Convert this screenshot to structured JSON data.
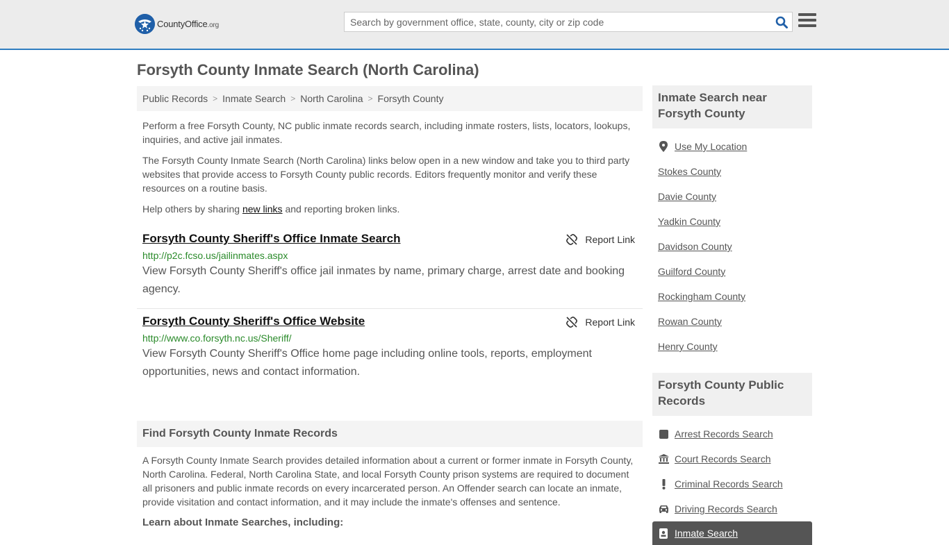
{
  "header": {
    "logo_main": "CountyOffice",
    "logo_tld": ".org",
    "search_placeholder": "Search by government office, state, county, city or zip code",
    "search_value": ""
  },
  "page_title": "Forsyth County Inmate Search (North Carolina)",
  "breadcrumb": [
    "Public Records",
    "Inmate Search",
    "North Carolina",
    "Forsyth County"
  ],
  "intro": {
    "p1": "Perform a free Forsyth County, NC public inmate records search, including inmate rosters, lists, locators, lookups, inquiries, and active jail inmates.",
    "p2": "The Forsyth County Inmate Search (North Carolina) links below open in a new window and take you to third party websites that provide access to Forsyth County public records. Editors frequently monitor and verify these resources on a routine basis.",
    "p3_before": "Help others by sharing ",
    "p3_link": "new links",
    "p3_after": " and reporting broken links."
  },
  "resources": [
    {
      "title": "Forsyth County Sheriff's Office Inmate Search",
      "url": "http://p2c.fcso.us/jailinmates.aspx",
      "description": "View Forsyth County Sheriff's office jail inmates by name, primary charge, arrest date and booking agency.",
      "report_label": "Report Link"
    },
    {
      "title": "Forsyth County Sheriff's Office Website",
      "url": "http://www.co.forsyth.nc.us/Sheriff/",
      "description": "View Forsyth County Sheriff's Office home page including online tools, reports, employment opportunities, news and contact information.",
      "report_label": "Report Link"
    }
  ],
  "find_section": {
    "heading": "Find Forsyth County Inmate Records",
    "body": "A Forsyth County Inmate Search provides detailed information about a current or former inmate in Forsyth County, North Carolina. Federal, North Carolina State, and local Forsyth County prison systems are required to document all prisoners and public inmate records on every incarcerated person. An Offender search can locate an inmate, provide visitation and contact information, and it may include the inmate's offenses and sentence.",
    "learn_heading": "Learn about Inmate Searches, including:"
  },
  "sidebar": {
    "nearby_heading": "Inmate Search near Forsyth County",
    "nearby_items": [
      {
        "label": "Use My Location",
        "icon": "map-pin-icon"
      },
      {
        "label": "Stokes County"
      },
      {
        "label": "Davie County"
      },
      {
        "label": "Yadkin County"
      },
      {
        "label": "Davidson County"
      },
      {
        "label": "Guilford County"
      },
      {
        "label": "Rockingham County"
      },
      {
        "label": "Rowan County"
      },
      {
        "label": "Henry County"
      }
    ],
    "records_heading": "Forsyth County Public Records",
    "records_items": [
      {
        "label": "Arrest Records Search",
        "icon": "square-icon"
      },
      {
        "label": "Court Records Search",
        "icon": "courthouse-icon"
      },
      {
        "label": "Criminal Records Search",
        "icon": "exclamation-icon"
      },
      {
        "label": "Driving Records Search",
        "icon": "car-icon"
      },
      {
        "label": "Inmate Search",
        "icon": "id-badge-icon",
        "active": true
      }
    ]
  }
}
